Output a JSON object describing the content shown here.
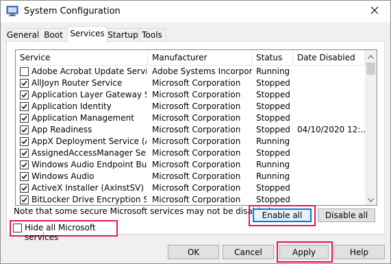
{
  "window": {
    "title": "System Configuration"
  },
  "tabs": [
    {
      "label": "General"
    },
    {
      "label": "Boot"
    },
    {
      "label": "Services"
    },
    {
      "label": "Startup"
    },
    {
      "label": "Tools"
    }
  ],
  "services": {
    "columns": [
      "Service",
      "Manufacturer",
      "Status",
      "Date Disabled"
    ],
    "rows": [
      {
        "name": "Adobe Acrobat Update Service",
        "manufacturer": "Adobe Systems Incorporated",
        "status": "Running",
        "date_disabled": "",
        "checked": false
      },
      {
        "name": "AllJoyn Router Service",
        "manufacturer": "Microsoft Corporation",
        "status": "Stopped",
        "date_disabled": "",
        "checked": true
      },
      {
        "name": "Application Layer Gateway Service",
        "manufacturer": "Microsoft Corporation",
        "status": "Stopped",
        "date_disabled": "",
        "checked": true
      },
      {
        "name": "Application Identity",
        "manufacturer": "Microsoft Corporation",
        "status": "Stopped",
        "date_disabled": "",
        "checked": true
      },
      {
        "name": "Application Management",
        "manufacturer": "Microsoft Corporation",
        "status": "Stopped",
        "date_disabled": "",
        "checked": true
      },
      {
        "name": "App Readiness",
        "manufacturer": "Microsoft Corporation",
        "status": "Stopped",
        "date_disabled": "04/10/2020 12:...",
        "checked": true
      },
      {
        "name": "AppX Deployment Service (AppX...",
        "manufacturer": "Microsoft Corporation",
        "status": "Running",
        "date_disabled": "",
        "checked": true
      },
      {
        "name": "AssignedAccessManager Service",
        "manufacturer": "Microsoft Corporation",
        "status": "Stopped",
        "date_disabled": "",
        "checked": true
      },
      {
        "name": "Windows Audio Endpoint Builder",
        "manufacturer": "Microsoft Corporation",
        "status": "Running",
        "date_disabled": "",
        "checked": true
      },
      {
        "name": "Windows Audio",
        "manufacturer": "Microsoft Corporation",
        "status": "Running",
        "date_disabled": "",
        "checked": true
      },
      {
        "name": "ActiveX Installer (AxInstSV)",
        "manufacturer": "Microsoft Corporation",
        "status": "Stopped",
        "date_disabled": "",
        "checked": true
      },
      {
        "name": "BitLocker Drive Encryption Service",
        "manufacturer": "Microsoft Corporation",
        "status": "Stopped",
        "date_disabled": "",
        "checked": true
      }
    ]
  },
  "note": "Note that some secure Microsoft services may not be disabled.",
  "hide_ms_label": "Hide all Microsoft services",
  "hide_ms_checked": false,
  "buttons": {
    "enable_all": "Enable all",
    "disable_all": "Disable all",
    "ok": "OK",
    "cancel": "Cancel",
    "apply": "Apply",
    "help": "Help"
  },
  "colors": {
    "highlight": "#e0194a",
    "accent": "#0078d7"
  },
  "icons": [
    "system-configuration-icon",
    "close-icon",
    "checkbox-check-icon",
    "scroll-up-icon",
    "scroll-down-icon"
  ]
}
